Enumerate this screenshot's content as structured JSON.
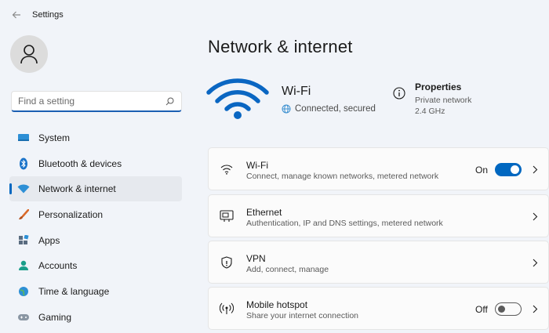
{
  "app": {
    "title": "Settings"
  },
  "sidebar": {
    "search_placeholder": "Find a setting",
    "items": [
      {
        "label": "System",
        "icon": "system-icon",
        "active": false
      },
      {
        "label": "Bluetooth & devices",
        "icon": "bluetooth-icon",
        "active": false
      },
      {
        "label": "Network & internet",
        "icon": "network-icon",
        "active": true
      },
      {
        "label": "Personalization",
        "icon": "brush-icon",
        "active": false
      },
      {
        "label": "Apps",
        "icon": "apps-icon",
        "active": false
      },
      {
        "label": "Accounts",
        "icon": "accounts-icon",
        "active": false
      },
      {
        "label": "Time & language",
        "icon": "globe-time-icon",
        "active": false
      },
      {
        "label": "Gaming",
        "icon": "gamepad-icon",
        "active": false
      }
    ]
  },
  "main": {
    "title": "Network & internet",
    "hero": {
      "name": "Wi-Fi",
      "status": "Connected, secured",
      "properties_title": "Properties",
      "properties_network": "Private network",
      "properties_band": "2.4 GHz"
    },
    "cards": [
      {
        "title": "Wi-Fi",
        "desc": "Connect, manage known networks, metered network",
        "toggle_label": "On",
        "toggle_on": true
      },
      {
        "title": "Ethernet",
        "desc": "Authentication, IP and DNS settings, metered network"
      },
      {
        "title": "VPN",
        "desc": "Add, connect, manage"
      },
      {
        "title": "Mobile hotspot",
        "desc": "Share your internet connection",
        "toggle_label": "Off",
        "toggle_on": false
      }
    ]
  },
  "colors": {
    "accent": "#0067c0",
    "background": "#f1f4f9",
    "card": "#fbfbfb"
  }
}
